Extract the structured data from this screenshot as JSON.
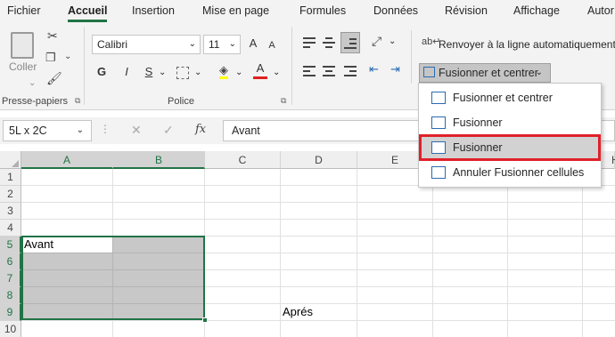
{
  "tabs": [
    "Fichier",
    "Accueil",
    "Insertion",
    "Mise en page",
    "Formules",
    "Données",
    "Révision",
    "Affichage",
    "Autor"
  ],
  "ribbon": {
    "clipboard": {
      "paste_label": "Coller",
      "group_label": "Presse-papiers"
    },
    "font": {
      "name": "Calibri",
      "size": "11",
      "grow": "A",
      "shrink": "A",
      "bold": "G",
      "italic": "I",
      "underline": "S",
      "color_letter": "A",
      "group_label": "Police"
    },
    "alignment": {
      "wrap_label": "Renvoyer à la ligne automatiquement",
      "merge_label": "Fusionner et centrer"
    }
  },
  "formula_bar": {
    "name_box": "5L x 2C",
    "cancel": "✕",
    "enter": "✓",
    "fx": "fx",
    "value": "Avant"
  },
  "grid": {
    "columns": [
      "A",
      "B",
      "C",
      "D",
      "E",
      "F",
      "G",
      "H"
    ],
    "rows": [
      "1",
      "2",
      "3",
      "4",
      "5",
      "6",
      "7",
      "8",
      "9",
      "10"
    ],
    "cell_A5": "Avant",
    "cell_D9": "Aprés"
  },
  "merge_menu": {
    "items": [
      {
        "label": "Fusionner et centrer"
      },
      {
        "label": "Fusionner"
      },
      {
        "label": "Fusionner"
      },
      {
        "label": "Annuler Fusionner cellules"
      }
    ]
  },
  "colors": {
    "accent": "#217346",
    "highlight": "#e0202a",
    "selection": "#c8c8c8"
  }
}
